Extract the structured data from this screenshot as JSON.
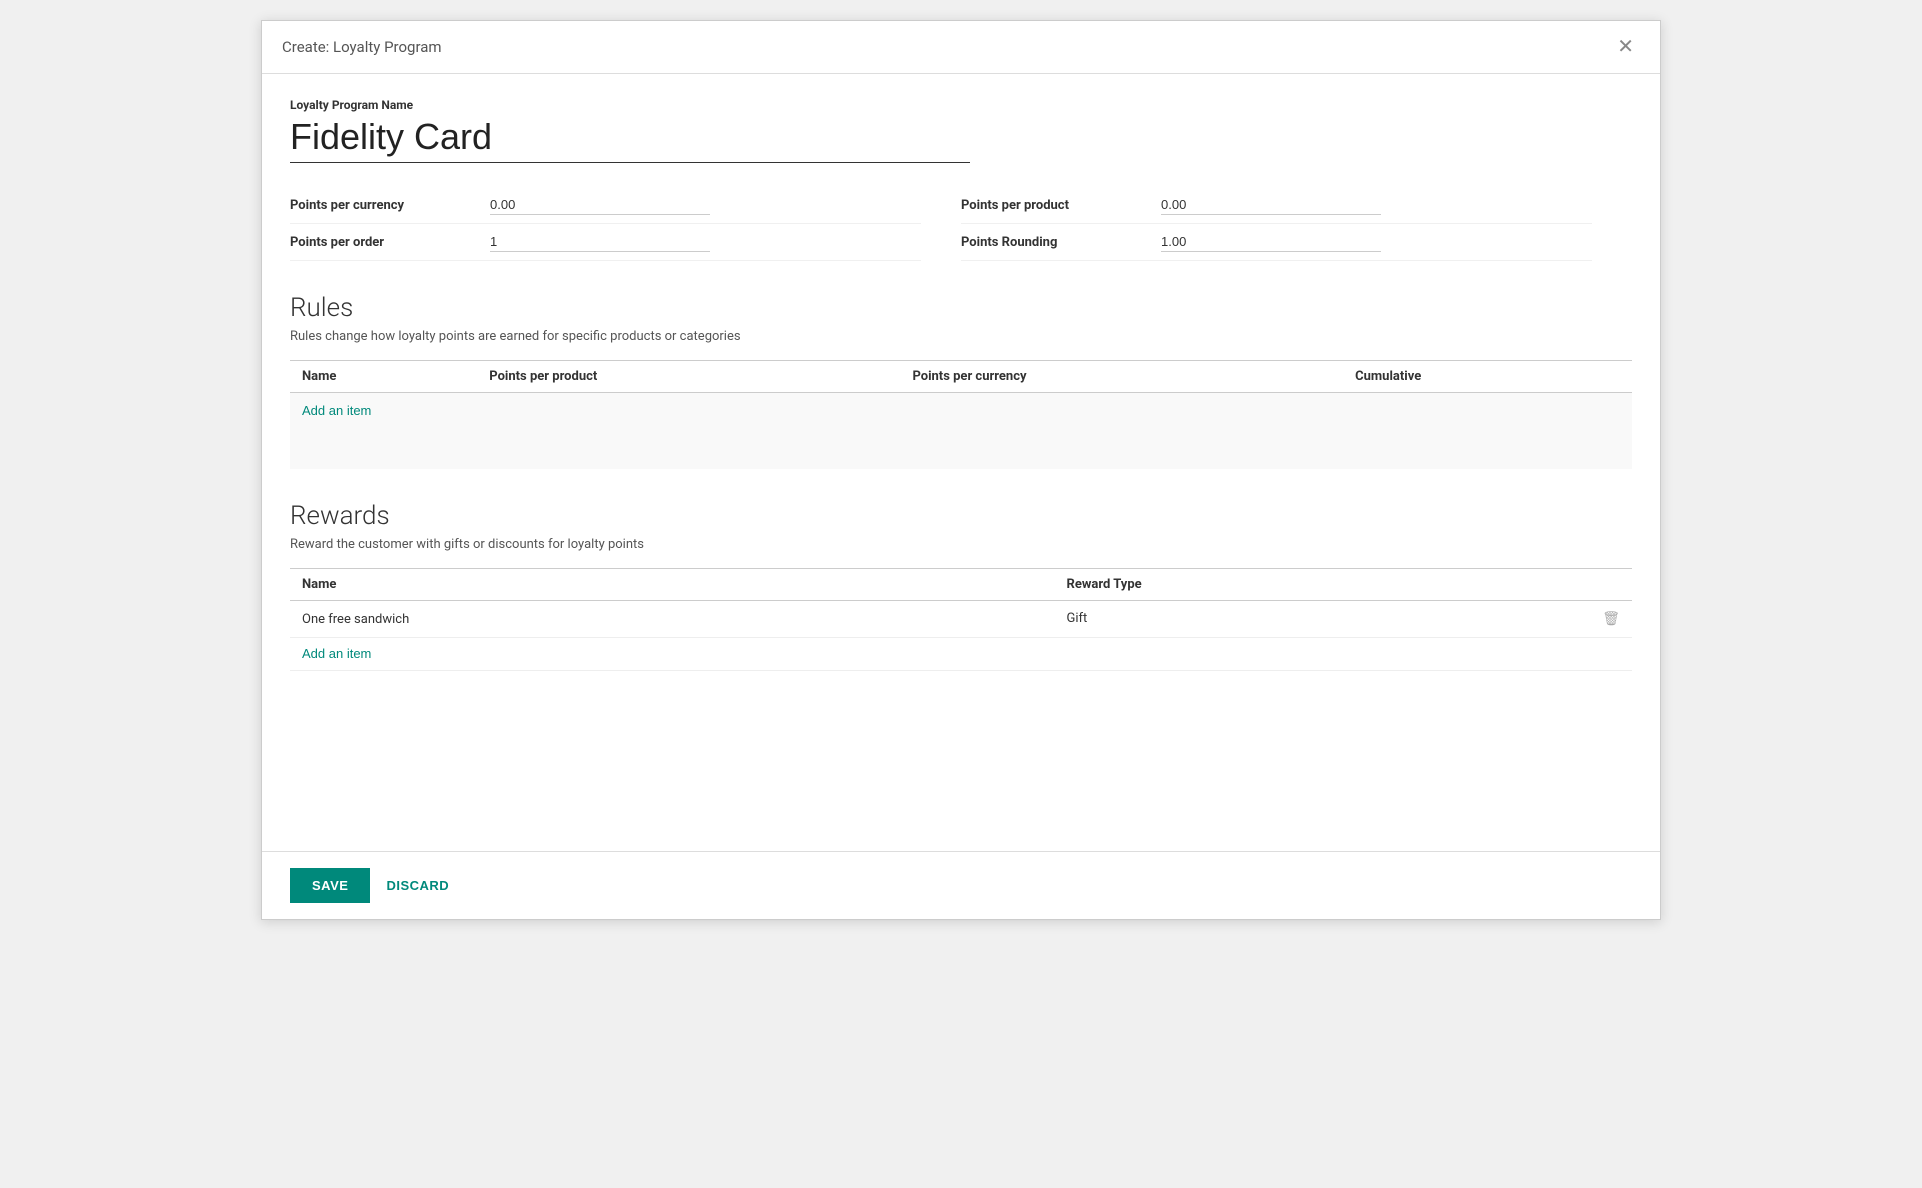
{
  "dialog": {
    "title": "Create: Loyalty Program",
    "close_icon": "×"
  },
  "form": {
    "program_name_label": "Loyalty Program Name",
    "program_name_value": "Fidelity Card",
    "program_name_placeholder": "Fidelity Card"
  },
  "fields": {
    "points_per_currency_label": "Points per currency",
    "points_per_currency_value": "0.00",
    "points_per_order_label": "Points per order",
    "points_per_order_value": "1",
    "points_per_product_label": "Points per product",
    "points_per_product_value": "0.00",
    "points_rounding_label": "Points Rounding",
    "points_rounding_value": "1.00"
  },
  "rules_section": {
    "title": "Rules",
    "description": "Rules change how loyalty points are earned for specific products or categories",
    "columns": [
      "Name",
      "Points per product",
      "Points per currency",
      "Cumulative"
    ],
    "add_item_label": "Add an item",
    "rows": []
  },
  "rewards_section": {
    "title": "Rewards",
    "description": "Reward the customer with gifts or discounts for loyalty points",
    "columns": [
      "Name",
      "Reward Type"
    ],
    "add_item_label": "Add an item",
    "rows": [
      {
        "name": "One free sandwich",
        "reward_type": "Gift"
      }
    ]
  },
  "footer": {
    "save_label": "SAVE",
    "discard_label": "DISCARD"
  },
  "icons": {
    "close": "✕",
    "delete": "🗑"
  }
}
